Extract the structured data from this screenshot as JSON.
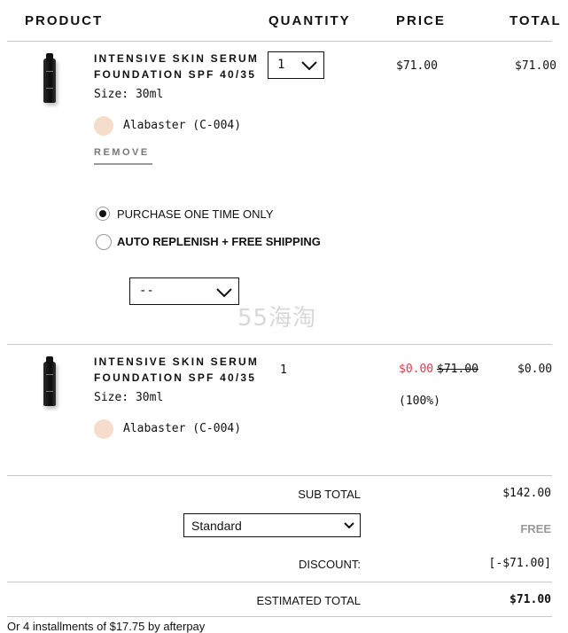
{
  "header": {
    "product": "PRODUCT",
    "quantity": "QUANTITY",
    "price": "PRICE",
    "total": "TOTAL"
  },
  "items": [
    {
      "name_line1": "INTENSIVE SKIN SERUM",
      "name_line2": "FOUNDATION SPF 40/35",
      "size": "Size: 30ml",
      "shade": "Alabaster (C-004)",
      "shade_color": "#f5dccb",
      "remove": "REMOVE",
      "quantity": "1",
      "price": "$71.00",
      "total": "$71.00",
      "options": {
        "one_time": "PURCHASE ONE TIME ONLY",
        "replenish": "AUTO REPLENISH + FREE SHIPPING",
        "frequency": "--"
      }
    },
    {
      "name_line1": "INTENSIVE SKIN SERUM",
      "name_line2": "FOUNDATION SPF 40/35",
      "size": "Size: 30ml",
      "shade": "Alabaster (C-004)",
      "shade_color": "#f5dccb",
      "quantity": "1",
      "sale_price": "$0.00",
      "original_price": "$71.00",
      "discount_pct": "(100%)",
      "total": "$0.00"
    }
  ],
  "summary": {
    "subtotal_label": "SUB TOTAL",
    "subtotal_value": "$142.00",
    "shipping_method": "Standard",
    "shipping_value": "FREE",
    "discount_label": "DISCOUNT:",
    "discount_value": "[-$71.00]",
    "estimated_label": "ESTIMATED TOTAL",
    "estimated_value": "$71.00"
  },
  "installments": "Or 4 installments of $17.75 by afterpay",
  "watermark": "55海淘",
  "colors": {
    "sale": "#e8344e",
    "rule": "#c8c8c8",
    "free": "#999999"
  }
}
